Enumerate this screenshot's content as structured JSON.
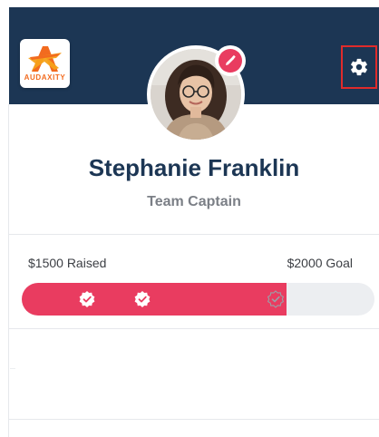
{
  "brand": {
    "logo_text": "AUDAXITY",
    "logo_icon": "audaxity-star-logo",
    "accent_orange": "#f26b1f",
    "header_navy": "#1c3654"
  },
  "header": {
    "settings_icon": "gear-icon",
    "edit_icon": "pencil-icon",
    "edit_badge_color": "#e93c60"
  },
  "profile": {
    "name": "Stephanie Franklin",
    "role": "Team Captain"
  },
  "fundraising": {
    "raised_label": "$1500 Raised",
    "goal_label": "$2000 Goal",
    "raised": 1500,
    "goal": 2000,
    "progress_color": "#e93c60",
    "track_color": "#eceef1",
    "milestones": [
      {
        "icon": "check-badge-icon",
        "reached": true
      },
      {
        "icon": "check-badge-icon",
        "reached": true
      },
      {
        "icon": "check-badge-icon",
        "reached": false
      }
    ]
  }
}
